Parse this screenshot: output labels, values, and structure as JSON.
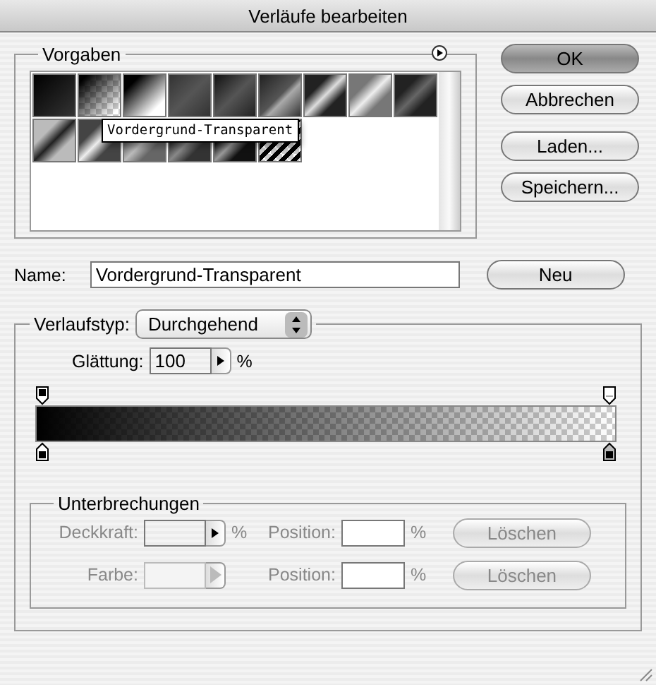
{
  "window": {
    "title": "Verläufe bearbeiten"
  },
  "presets": {
    "legend": "Vorgaben",
    "tooltip": "Vordergrund-Transparent"
  },
  "buttons": [
    {
      "label": "OK",
      "default": true
    },
    {
      "label": "Abbrechen",
      "default": false
    },
    {
      "label": "Laden...",
      "default": false
    },
    {
      "label": "Speichern...",
      "default": false
    }
  ],
  "name": {
    "label": "Name:",
    "value": "Vordergrund-Transparent",
    "button": "Neu"
  },
  "gradient": {
    "type_label": "Verlaufstyp:",
    "type_value": "Durchgehend",
    "smoothness_label": "Glättung:",
    "smoothness_value": "100",
    "smoothness_unit": "%"
  },
  "stops": {
    "legend": "Unterbrechungen",
    "rows": [
      {
        "label": "Deckkraft:",
        "unit": "%",
        "position_label": "Position:",
        "position_unit": "%",
        "button": "Löschen",
        "disabled": true
      },
      {
        "label": "Farbe:",
        "position_label": "Position:",
        "position_unit": "%",
        "button": "Löschen",
        "disabled": true
      }
    ]
  }
}
